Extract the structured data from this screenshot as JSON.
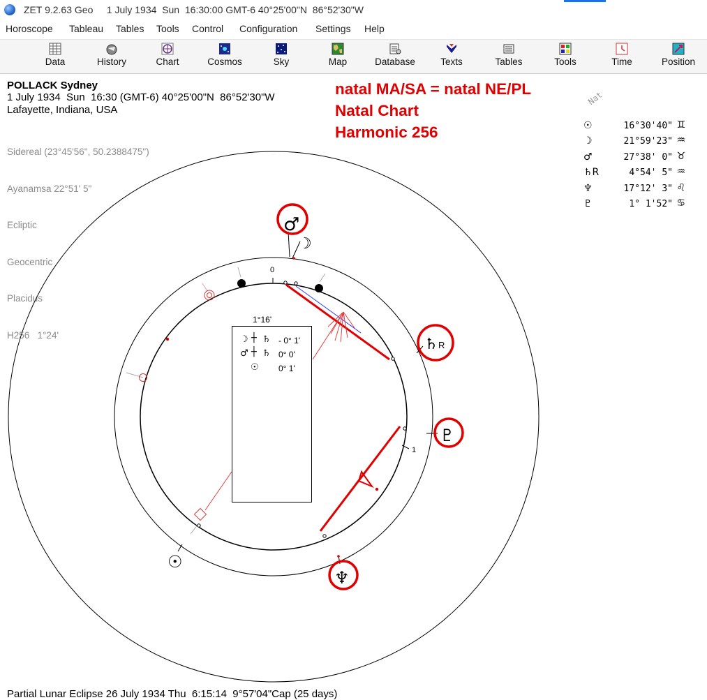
{
  "window": {
    "title": "ZET 9.2.63 Geo     1 July 1934  Sun  16:30:00 GMT-6 40°25'00\"N  86°52'30\"W"
  },
  "menu": [
    "Horoscope",
    "Tableau",
    "Tables",
    "Tools",
    "Control",
    "Configuration",
    "Settings",
    "Help"
  ],
  "toolbar": {
    "buttons": [
      {
        "label": "Data",
        "icon": "data-grid-icon"
      },
      {
        "label": "History",
        "icon": "history-icon"
      },
      {
        "label": "Chart",
        "icon": "chart-wheel-icon"
      },
      {
        "label": "Cosmos",
        "icon": "cosmos-icon"
      },
      {
        "label": "Sky",
        "icon": "sky-icon"
      },
      {
        "label": "Map",
        "icon": "map-icon"
      },
      {
        "label": "Database",
        "icon": "database-icon"
      },
      {
        "label": "Texts",
        "icon": "texts-icon"
      },
      {
        "label": "Tables",
        "icon": "tables-icon"
      },
      {
        "label": "Tools",
        "icon": "tools-icon"
      },
      {
        "label": "Time",
        "icon": "time-icon"
      },
      {
        "label": "Position",
        "icon": "position-icon"
      }
    ]
  },
  "chart_info": {
    "name": "POLLACK Sydney",
    "date_line": "1 July 1934  Sun  16:30 (GMT-6) 40°25'00\"N  86°52'30\"W",
    "location": "Lafayette, Indiana, USA",
    "settings": [
      "Sidereal (23°45'56\", 50.2388475\")",
      "Ayanamsa 22°51' 5\"",
      "Ecliptic",
      "Geocentric",
      "Placidus",
      "H256   1°24'"
    ]
  },
  "annotation": {
    "line1": "natal MA/SA = natal NE/PL",
    "line2": "Natal Chart",
    "line3": "Harmonic 256",
    "color": "#e00000"
  },
  "positions_panel": {
    "label": "Nat",
    "rows": [
      {
        "glyph": "☉",
        "value": "16°30'40\"",
        "sign": "♊"
      },
      {
        "glyph": "☽",
        "value": "21°59'23\"",
        "sign": "♒"
      },
      {
        "glyph": "♂",
        "value": "27°38' 0\"",
        "sign": "♉"
      },
      {
        "glyph": "♄R",
        "value": "4°54' 5\"",
        "sign": "♒"
      },
      {
        "glyph": "♆",
        "value": "17°12' 3\"",
        "sign": "♌"
      },
      {
        "glyph": "♇",
        "value": "1° 1'52\"",
        "sign": "♋"
      }
    ]
  },
  "wheel": {
    "tick_label_top": "0",
    "tick_label_right": "1",
    "planet_glyphs": {
      "mars": "♂",
      "moon": "☽",
      "saturn": "♄",
      "saturn_retro": "R",
      "pluto": "♇",
      "sun": "☉",
      "neptune": "♆"
    }
  },
  "midpoint_box": {
    "title": "1°16'",
    "rows": [
      {
        "a": "☽",
        "b": "♄",
        "value": "- 0° 1'"
      },
      {
        "a": "♂",
        "b": "♄",
        "value": "0° 0'"
      },
      {
        "a": "",
        "b": "☉",
        "value": "0° 1'"
      }
    ]
  },
  "footer": {
    "text": "Partial Lunar Eclipse 26 July 1934 Thu  6:15:14  9°57'04\"Cap (25 days)"
  }
}
